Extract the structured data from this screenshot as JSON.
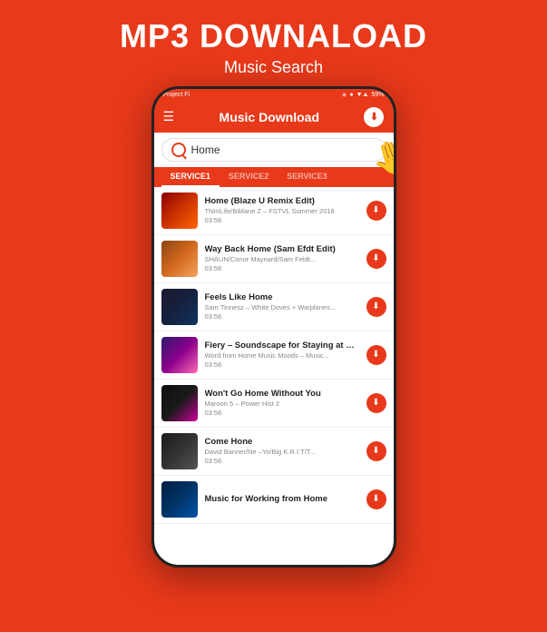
{
  "header": {
    "main_title": "MP3 DOWNALOAD",
    "sub_title": "Music Search"
  },
  "status_bar": {
    "carrier": "Project Fi",
    "time": "59%",
    "icons": "✳ ● ▼▲ ▌"
  },
  "nav": {
    "title": "Music Download",
    "hamburger_label": "☰",
    "download_icon_label": "⬇"
  },
  "search": {
    "placeholder": "Home",
    "value": "Home"
  },
  "tabs": [
    {
      "label": "SERVICE1",
      "active": true
    },
    {
      "label": "SERVICE2",
      "active": false
    },
    {
      "label": "SERVICE3",
      "active": false
    }
  ],
  "songs": [
    {
      "title": "Home  (Blaze U Remix Edit)",
      "artist": "ThimLife/Biblane Z – FSTVL Summer 2018",
      "duration": "03:56",
      "thumb_class": "thumb-1"
    },
    {
      "title": "Way Back Home  (Sam Efdt Edit)",
      "artist": "SHAUN/Conor Maynard/Sam Feldt...",
      "duration": "03:56",
      "thumb_class": "thumb-2"
    },
    {
      "title": "Feels Like Home",
      "artist": "Sam Tinnesz – White Doves + Warplanes...",
      "duration": "03:56",
      "thumb_class": "thumb-3"
    },
    {
      "title": "Fiery – Soundscape for Staying at Home",
      "artist": "Word from Home Music Moods – Music...",
      "duration": "03:56",
      "thumb_class": "thumb-4"
    },
    {
      "title": "Won't Go Home Without You",
      "artist": "Maroon 5 – Power Hist 2",
      "duration": "03:56",
      "thumb_class": "thumb-5"
    },
    {
      "title": "Come Hone",
      "artist": "David Banner/Ne –Yo/Big K.R.I.T/T...",
      "duration": "03:56",
      "thumb_class": "thumb-6"
    },
    {
      "title": "Music for Working from Home",
      "artist": "",
      "duration": "",
      "thumb_class": "thumb-7"
    }
  ]
}
